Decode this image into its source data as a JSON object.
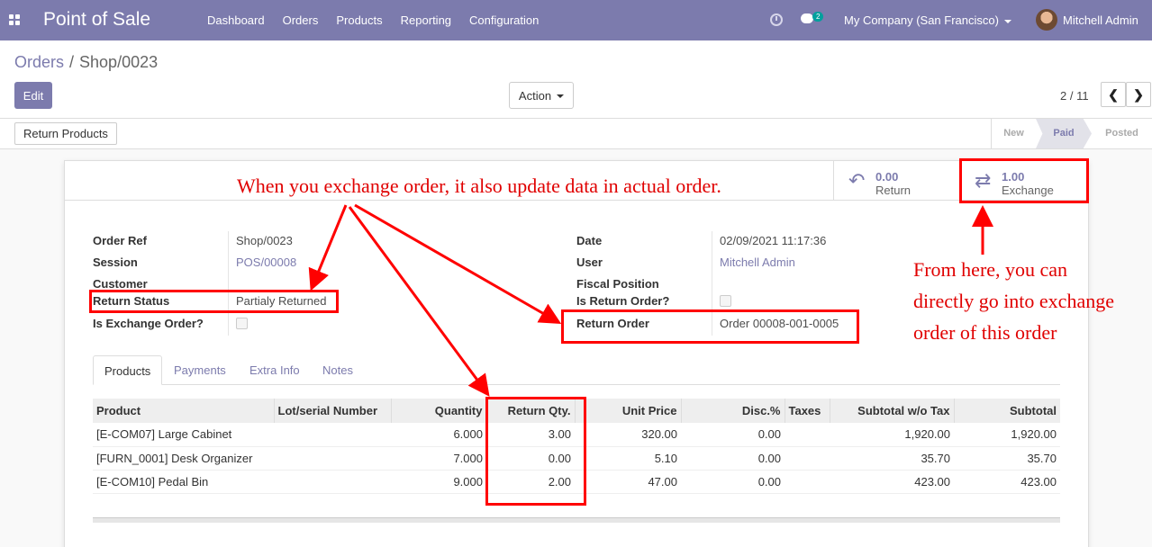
{
  "navbar": {
    "brand": "Point of Sale",
    "menu": [
      "Dashboard",
      "Orders",
      "Products",
      "Reporting",
      "Configuration"
    ],
    "chat_count": "2",
    "company": "My Company (San Francisco)",
    "user": "Mitchell Admin",
    "color": "#7c7bad"
  },
  "breadcrumb": {
    "parent": "Orders",
    "separator": "/",
    "current": "Shop/0023"
  },
  "buttons": {
    "edit": "Edit",
    "action": "Action",
    "return_products": "Return Products"
  },
  "pager": {
    "text": "2 / 11",
    "prev": "❮",
    "next": "❯"
  },
  "stages": {
    "new": "New",
    "paid": "Paid",
    "posted": "Posted",
    "current": "Paid"
  },
  "smart_buttons": {
    "return": {
      "value": "0.00",
      "label": "Return"
    },
    "exchange": {
      "value": "1.00",
      "label": "Exchange"
    }
  },
  "form": {
    "left": {
      "order_ref_label": "Order Ref",
      "order_ref": "Shop/0023",
      "session_label": "Session",
      "session": "POS/00008",
      "customer_label": "Customer",
      "customer": "",
      "return_status_label": "Return Status",
      "return_status": "Partialy Returned",
      "is_exchange_label": "Is Exchange Order?"
    },
    "right": {
      "date_label": "Date",
      "date": "02/09/2021 11:17:36",
      "user_label": "User",
      "user": "Mitchell Admin",
      "fiscal_label": "Fiscal Position",
      "is_return_label": "Is Return Order?",
      "return_order_label": "Return Order",
      "return_order": "Order 00008-001-0005"
    }
  },
  "tabs": [
    "Products",
    "Payments",
    "Extra Info",
    "Notes"
  ],
  "table": {
    "headers": [
      "Product",
      "Lot/serial Number",
      "Quantity",
      "Return Qty.",
      "Unit Price",
      "Disc.%",
      "Taxes",
      "Subtotal w/o Tax",
      "Subtotal"
    ],
    "rows": [
      {
        "product": "[E-COM07] Large Cabinet",
        "lot": "",
        "qty": "6.000",
        "return_qty": "3.00",
        "unit_price": "320.00",
        "disc": "0.00",
        "taxes": "",
        "subtotal_wo_tax": "1,920.00",
        "subtotal": "1,920.00"
      },
      {
        "product": "[FURN_0001] Desk Organizer",
        "lot": "",
        "qty": "7.000",
        "return_qty": "0.00",
        "unit_price": "5.10",
        "disc": "0.00",
        "taxes": "",
        "subtotal_wo_tax": "35.70",
        "subtotal": "35.70"
      },
      {
        "product": "[E-COM10] Pedal Bin",
        "lot": "",
        "qty": "9.000",
        "return_qty": "2.00",
        "unit_price": "47.00",
        "disc": "0.00",
        "taxes": "",
        "subtotal_wo_tax": "423.00",
        "subtotal": "423.00"
      }
    ]
  },
  "annotations": {
    "top": "When you exchange order, it also update data in actual order.",
    "right_line1": "From here, you can",
    "right_line2": "directly go into exchange",
    "right_line3": "order of this order",
    "color": "#ff0000"
  }
}
